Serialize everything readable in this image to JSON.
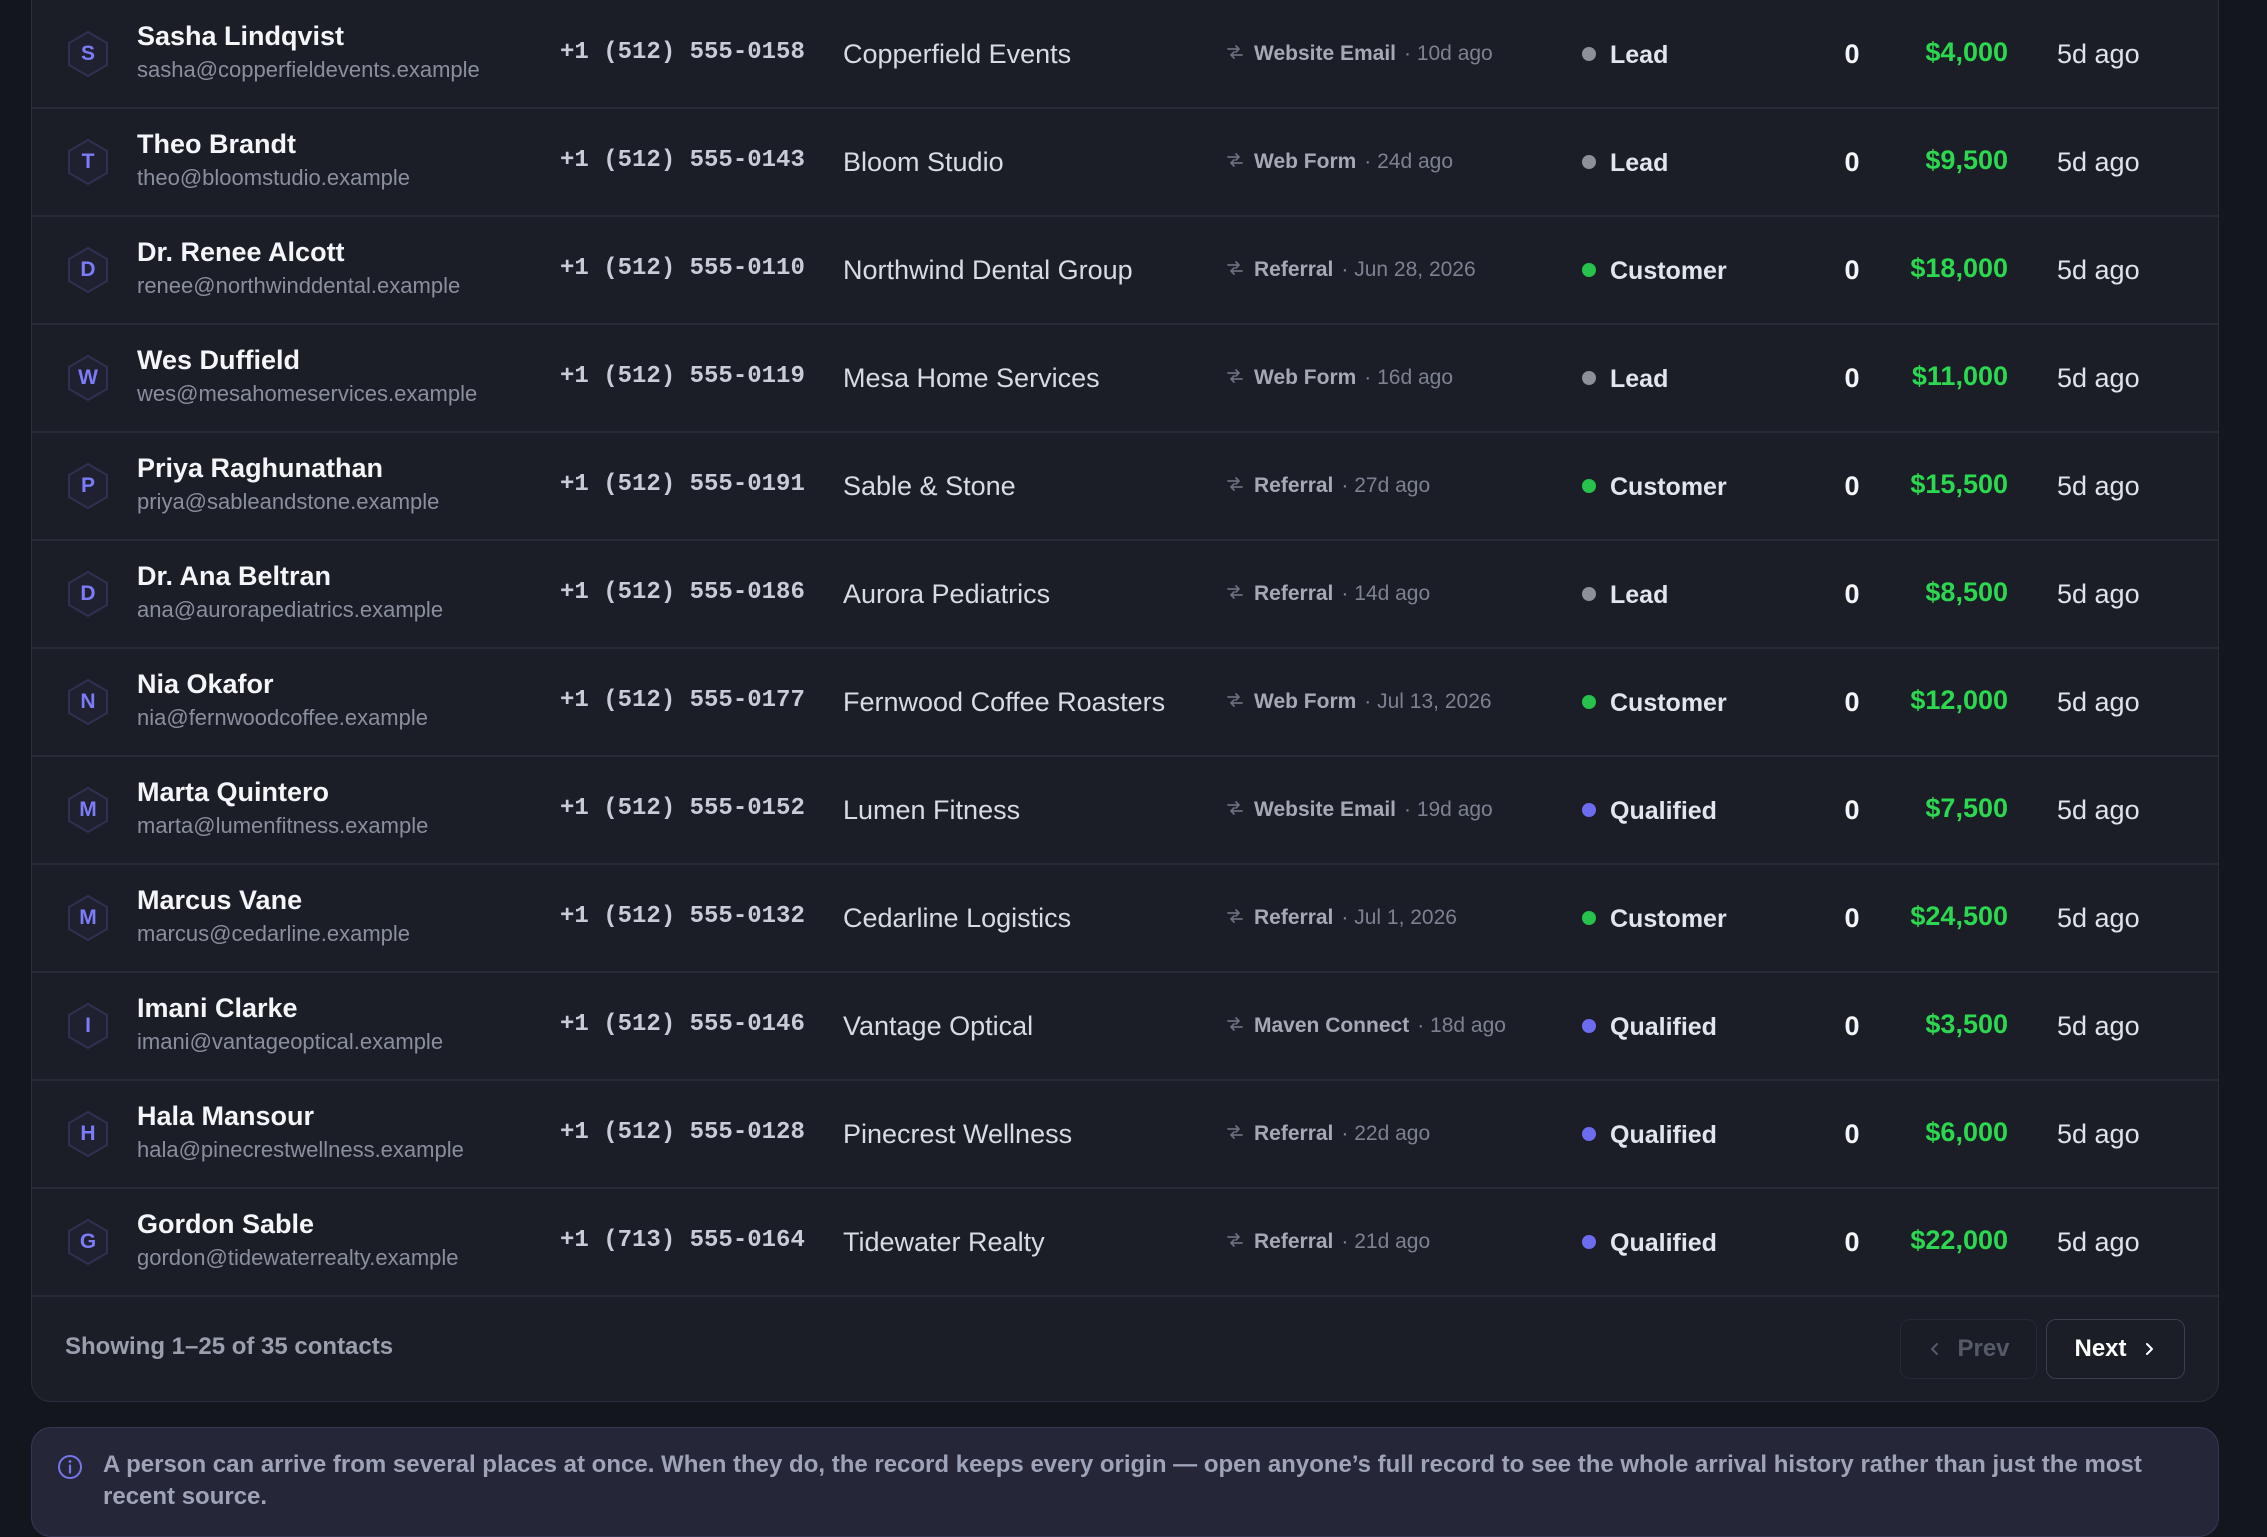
{
  "contacts": [
    {
      "initial": "S",
      "name": "Sasha Lindqvist",
      "email": "sasha@copperfieldevents.example",
      "phone": "+1 (512) 555-0158",
      "company": "Copperfield Events",
      "source": "Website Email",
      "source_time": "· 10d ago",
      "status": "Lead",
      "status_color": "#8d8f99",
      "count": "0",
      "value": "$4,000",
      "updated": "5d ago"
    },
    {
      "initial": "T",
      "name": "Theo Brandt",
      "email": "theo@bloomstudio.example",
      "phone": "+1 (512) 555-0143",
      "company": "Bloom Studio",
      "source": "Web Form",
      "source_time": "· 24d ago",
      "status": "Lead",
      "status_color": "#8d8f99",
      "count": "0",
      "value": "$9,500",
      "updated": "5d ago"
    },
    {
      "initial": "D",
      "name": "Dr. Renee Alcott",
      "email": "renee@northwinddental.example",
      "phone": "+1 (512) 555-0110",
      "company": "Northwind Dental Group",
      "source": "Referral",
      "source_time": "· Jun 28, 2026",
      "status": "Customer",
      "status_color": "#27c24c",
      "count": "0",
      "value": "$18,000",
      "updated": "5d ago"
    },
    {
      "initial": "W",
      "name": "Wes Duffield",
      "email": "wes@mesahomeservices.example",
      "phone": "+1 (512) 555-0119",
      "company": "Mesa Home Services",
      "source": "Web Form",
      "source_time": "· 16d ago",
      "status": "Lead",
      "status_color": "#8d8f99",
      "count": "0",
      "value": "$11,000",
      "updated": "5d ago"
    },
    {
      "initial": "P",
      "name": "Priya Raghunathan",
      "email": "priya@sableandstone.example",
      "phone": "+1 (512) 555-0191",
      "company": "Sable & Stone",
      "source": "Referral",
      "source_time": "· 27d ago",
      "status": "Customer",
      "status_color": "#27c24c",
      "count": "0",
      "value": "$15,500",
      "updated": "5d ago"
    },
    {
      "initial": "D",
      "name": "Dr. Ana Beltran",
      "email": "ana@aurorapediatrics.example",
      "phone": "+1 (512) 555-0186",
      "company": "Aurora Pediatrics",
      "source": "Referral",
      "source_time": "· 14d ago",
      "status": "Lead",
      "status_color": "#8d8f99",
      "count": "0",
      "value": "$8,500",
      "updated": "5d ago"
    },
    {
      "initial": "N",
      "name": "Nia Okafor",
      "email": "nia@fernwoodcoffee.example",
      "phone": "+1 (512) 555-0177",
      "company": "Fernwood Coffee Roasters",
      "source": "Web Form",
      "source_time": "· Jul 13, 2026",
      "status": "Customer",
      "status_color": "#27c24c",
      "count": "0",
      "value": "$12,000",
      "updated": "5d ago"
    },
    {
      "initial": "M",
      "name": "Marta Quintero",
      "email": "marta@lumenfitness.example",
      "phone": "+1 (512) 555-0152",
      "company": "Lumen Fitness",
      "source": "Website Email",
      "source_time": "· 19d ago",
      "status": "Qualified",
      "status_color": "#6d6cf0",
      "count": "0",
      "value": "$7,500",
      "updated": "5d ago"
    },
    {
      "initial": "M",
      "name": "Marcus Vane",
      "email": "marcus@cedarline.example",
      "phone": "+1 (512) 555-0132",
      "company": "Cedarline Logistics",
      "source": "Referral",
      "source_time": "· Jul 1, 2026",
      "status": "Customer",
      "status_color": "#27c24c",
      "count": "0",
      "value": "$24,500",
      "updated": "5d ago"
    },
    {
      "initial": "I",
      "name": "Imani Clarke",
      "email": "imani@vantageoptical.example",
      "phone": "+1 (512) 555-0146",
      "company": "Vantage Optical",
      "source": "Maven Connect",
      "source_time": "· 18d ago",
      "status": "Qualified",
      "status_color": "#6d6cf0",
      "count": "0",
      "value": "$3,500",
      "updated": "5d ago"
    },
    {
      "initial": "H",
      "name": "Hala Mansour",
      "email": "hala@pinecrestwellness.example",
      "phone": "+1 (512) 555-0128",
      "company": "Pinecrest Wellness",
      "source": "Referral",
      "source_time": "· 22d ago",
      "status": "Qualified",
      "status_color": "#6d6cf0",
      "count": "0",
      "value": "$6,000",
      "updated": "5d ago"
    },
    {
      "initial": "G",
      "name": "Gordon Sable",
      "email": "gordon@tidewaterrealty.example",
      "phone": "+1 (713) 555-0164",
      "company": "Tidewater Realty",
      "source": "Referral",
      "source_time": "· 21d ago",
      "status": "Qualified",
      "status_color": "#6d6cf0",
      "count": "0",
      "value": "$22,000",
      "updated": "5d ago"
    }
  ],
  "pagination": {
    "showing": "Showing 1–25 of 35 contacts",
    "prev_label": "Prev",
    "next_label": "Next"
  },
  "notice": {
    "icon": "info-icon",
    "text": "A person can arrive from several places at once. When they do, the record keeps every origin — open anyone’s full record to see the whole arrival history rather than just the most recent source."
  },
  "colors": {
    "value_green": "#2bd84f",
    "accent_purple": "#7b7cf6"
  }
}
